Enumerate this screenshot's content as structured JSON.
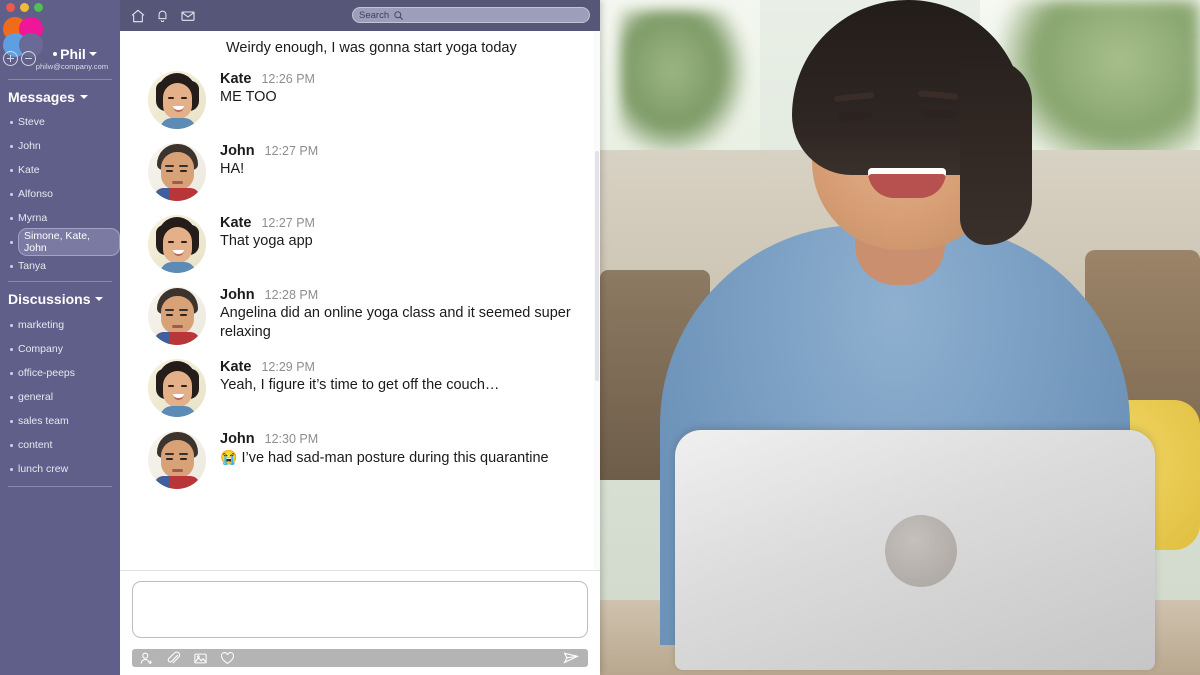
{
  "window": {
    "traffic_lights": [
      "close",
      "minimize",
      "maximize"
    ],
    "logo_name": "flower-logo"
  },
  "sidebar": {
    "account": {
      "name": "Phil",
      "email": "philw@company.com",
      "add_icon": "plus-circle-icon",
      "remove_icon": "minus-circle-icon",
      "caret": "chevron-down-icon"
    },
    "sections": [
      {
        "title": "Messages",
        "items": [
          {
            "label": "Steve",
            "selected": false
          },
          {
            "label": "John",
            "selected": false
          },
          {
            "label": "Kate",
            "selected": false
          },
          {
            "label": "Alfonso",
            "selected": false
          },
          {
            "label": "Myrna",
            "selected": false
          },
          {
            "label": "Simone, Kate, John",
            "selected": true
          },
          {
            "label": "Tanya",
            "selected": false
          }
        ]
      },
      {
        "title": "Discussions",
        "items": [
          {
            "label": "marketing",
            "selected": false
          },
          {
            "label": "Company",
            "selected": false
          },
          {
            "label": "office-peeps",
            "selected": false
          },
          {
            "label": "general",
            "selected": false
          },
          {
            "label": "sales team",
            "selected": false
          },
          {
            "label": "content",
            "selected": false
          },
          {
            "label": "lunch crew",
            "selected": false
          }
        ]
      }
    ]
  },
  "topbar": {
    "icons": [
      "home-icon",
      "bell-icon",
      "envelope-icon"
    ],
    "search": {
      "label": "Search",
      "icon": "search-icon"
    }
  },
  "conversation": {
    "leading_message": "Weirdy enough, I was gonna start yoga today",
    "messages": [
      {
        "author": "Kate",
        "time": "12:26 PM",
        "text": "ME TOO",
        "avatar": "kate"
      },
      {
        "author": "John",
        "time": "12:27 PM",
        "text": "HA!",
        "avatar": "john"
      },
      {
        "author": "Kate",
        "time": "12:27 PM",
        "text": "That yoga app",
        "avatar": "kate"
      },
      {
        "author": "John",
        "time": "12:28 PM",
        "text": "Angelina did an online yoga class and it seemed super relaxing",
        "avatar": "john"
      },
      {
        "author": "Kate",
        "time": "12:29 PM",
        "text": "Yeah, I figure it’s time to get off the couch…",
        "avatar": "kate"
      },
      {
        "author": "John",
        "time": "12:30 PM",
        "emoji": "😭",
        "text": " I’ve had sad-man posture during this quarantine",
        "avatar": "john"
      }
    ]
  },
  "composer": {
    "value": "",
    "placeholder": "",
    "tools": [
      "add-person-icon",
      "paperclip-icon",
      "image-icon",
      "heart-icon"
    ],
    "send_icon": "send-paper-plane-icon"
  },
  "colors": {
    "sidebar_bg": "#605f89",
    "topbar_bg": "#565678",
    "selected_pill": "#7b7aa3",
    "composer_bar": "#b4b4b4",
    "text_dark": "#1b1b1b",
    "timestamp": "#8e8e8e"
  }
}
